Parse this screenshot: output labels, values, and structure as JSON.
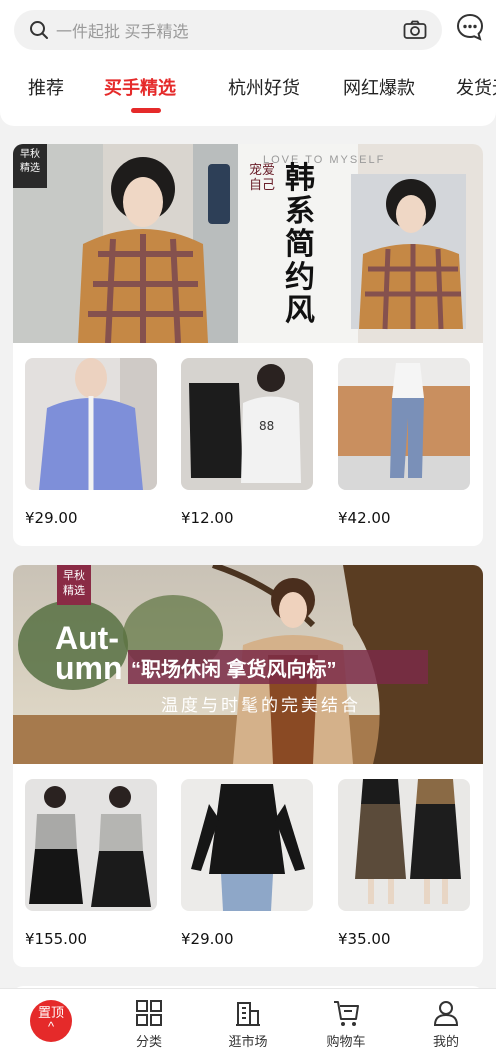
{
  "search": {
    "placeholder": "一件起批 买手精选"
  },
  "tabs": [
    {
      "label": "推荐"
    },
    {
      "label": "买手精选"
    },
    {
      "label": "杭州好货"
    },
    {
      "label": "网红爆款"
    },
    {
      "label": "发货无"
    }
  ],
  "cards": [
    {
      "badge": [
        "早秋",
        "精选"
      ],
      "banner_title_vertical": [
        "韩",
        "系",
        "简",
        "约",
        "风"
      ],
      "banner_small_text": [
        "宠爱",
        "自己"
      ],
      "banner_top_text": "LOVE TO MYSELF",
      "products": [
        {
          "price": "¥29.00"
        },
        {
          "price": "¥12.00"
        },
        {
          "price": "¥42.00"
        }
      ]
    },
    {
      "badge": [
        "早秋",
        "精选"
      ],
      "banner_big": [
        "Aut-",
        "umn"
      ],
      "banner_headline": "“职场休闲 拿货风向标”",
      "banner_sub": "温度与时髦的完美结合",
      "products": [
        {
          "price": "¥155.00"
        },
        {
          "price": "¥29.00"
        },
        {
          "price": "¥35.00"
        }
      ]
    }
  ],
  "bottom_nav": {
    "top_button": [
      "置顶",
      "^"
    ],
    "items": [
      {
        "label": "分类",
        "icon": "grid-icon"
      },
      {
        "label": "逛市场",
        "icon": "building-icon"
      },
      {
        "label": "购物车",
        "icon": "cart-icon"
      },
      {
        "label": "我的",
        "icon": "user-icon"
      }
    ]
  },
  "colors": {
    "accent": "#e52a2a",
    "badge_plum": "#8a2b45"
  }
}
